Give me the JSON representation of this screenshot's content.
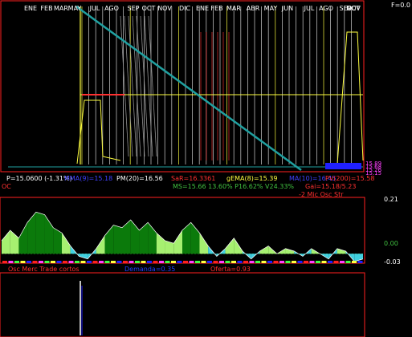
{
  "top_months": [
    "ENE",
    "FEB",
    "MAR",
    "MAY",
    "JUL",
    "AGO",
    "SEP",
    "OCT",
    "NOV",
    "DIC",
    "ENE",
    "FEB",
    "MAR",
    "ABR",
    "MAY",
    "JUN",
    "JUL",
    "AGO",
    "SEP",
    "OCT",
    "NOV"
  ],
  "corner_label": "F=0.0",
  "info_row1": {
    "price": "P=15.0600 (-1.31%)",
    "mma": "MMA(9)=15.18",
    "pm": "PM(20)=16.56",
    "sar": "SaR=16.3361",
    "gema": "gEMA(8)=15.39",
    "mid": "MA(10)=16.45",
    "pv": "PV(200)=15.58"
  },
  "info_row2": {
    "left": "OC",
    "ms": "MS=15.66 13.60% P16.62% V24.33%",
    "gain": "Gai=15.18/5.23"
  },
  "right_axis_tags": [
    "15.89",
    "15.68",
    "15.26",
    "15.15"
  ],
  "osc": {
    "title": "-2 Mic Osc Str",
    "ticks": [
      "0.21",
      "0.00",
      "-0.03"
    ]
  },
  "bottom_labels": {
    "left": "Osc Merc Trade cortos",
    "demand": "Demanda=0.35",
    "offer": "Oferta=0.93"
  },
  "colors": {
    "frame": "#ff2020",
    "yellow": "#ffff40",
    "teal": "#20a0a0",
    "white": "#e8e8e8",
    "grey": "#909090",
    "red": "#ff3030",
    "dgreen": "#0b7a0b",
    "lgreen": "#a6f070",
    "cyan": "#40d0e0",
    "blue": "#2020ff"
  },
  "chart_data": {
    "type": "area",
    "title": "-2 Mic Osc Str",
    "ylim": [
      -0.03,
      0.21
    ],
    "series": [
      {
        "values": [
          0.05,
          0.09,
          0.06,
          0.12,
          0.16,
          0.15,
          0.1,
          0.08,
          0.03,
          -0.01,
          -0.02,
          0.02,
          0.07,
          0.11,
          0.1,
          0.13,
          0.09,
          0.12,
          0.08,
          0.05,
          0.04,
          0.09,
          0.12,
          0.08,
          0.03,
          -0.01,
          0.02,
          0.06,
          0.01,
          -0.02,
          0.01,
          0.03,
          0.0,
          0.02,
          0.01,
          -0.01,
          0.02,
          0.0,
          -0.02,
          0.02,
          0.01,
          -0.03,
          -0.02
        ]
      }
    ]
  }
}
